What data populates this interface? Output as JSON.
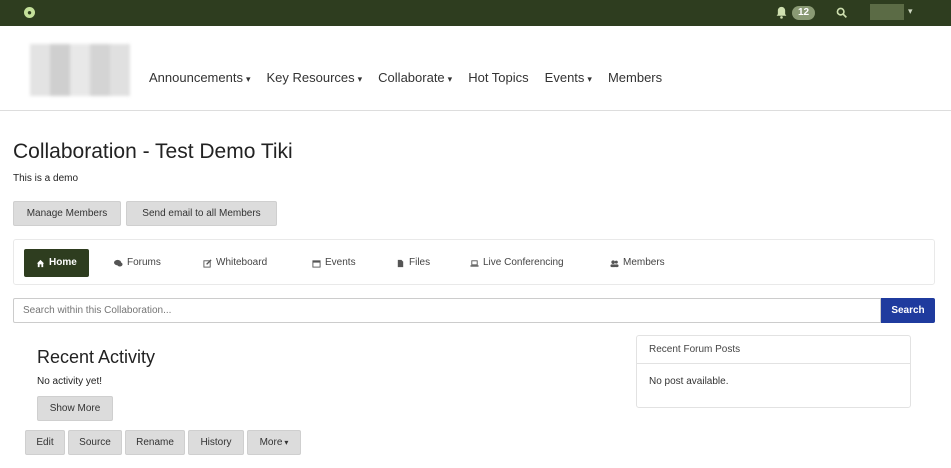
{
  "topbar": {
    "notification_count": "12"
  },
  "nav": {
    "items": [
      {
        "label": "Announcements",
        "dropdown": true
      },
      {
        "label": "Key Resources",
        "dropdown": true
      },
      {
        "label": "Collaborate",
        "dropdown": true
      },
      {
        "label": "Hot Topics",
        "dropdown": false
      },
      {
        "label": "Events",
        "dropdown": true
      },
      {
        "label": "Members",
        "dropdown": false
      }
    ],
    "caret": "▾"
  },
  "page": {
    "title": "Collaboration - Test Demo Tiki",
    "subtitle": "This is a demo"
  },
  "actions": {
    "manage_members": "Manage Members",
    "send_email": "Send email to all Members"
  },
  "tabs": [
    {
      "label": "Home",
      "icon": "home-icon",
      "active": true
    },
    {
      "label": "Forums",
      "icon": "comments-icon",
      "active": false
    },
    {
      "label": "Whiteboard",
      "icon": "edit-icon",
      "active": false
    },
    {
      "label": "Events",
      "icon": "calendar-icon",
      "active": false
    },
    {
      "label": "Files",
      "icon": "file-icon",
      "active": false
    },
    {
      "label": "Live Conferencing",
      "icon": "laptop-icon",
      "active": false
    },
    {
      "label": "Members",
      "icon": "users-icon",
      "active": false
    }
  ],
  "search": {
    "placeholder": "Search within this Collaboration...",
    "button": "Search"
  },
  "recent_activity": {
    "title": "Recent Activity",
    "empty": "No activity yet!",
    "show_more": "Show More"
  },
  "forum_panel": {
    "title": "Recent Forum Posts",
    "empty": "No post available."
  },
  "page_actions": {
    "edit": "Edit",
    "source": "Source",
    "rename": "Rename",
    "history": "History",
    "more": "More"
  },
  "colors": {
    "topbar": "#2e3d1f",
    "search_button": "#1f3b9e"
  }
}
